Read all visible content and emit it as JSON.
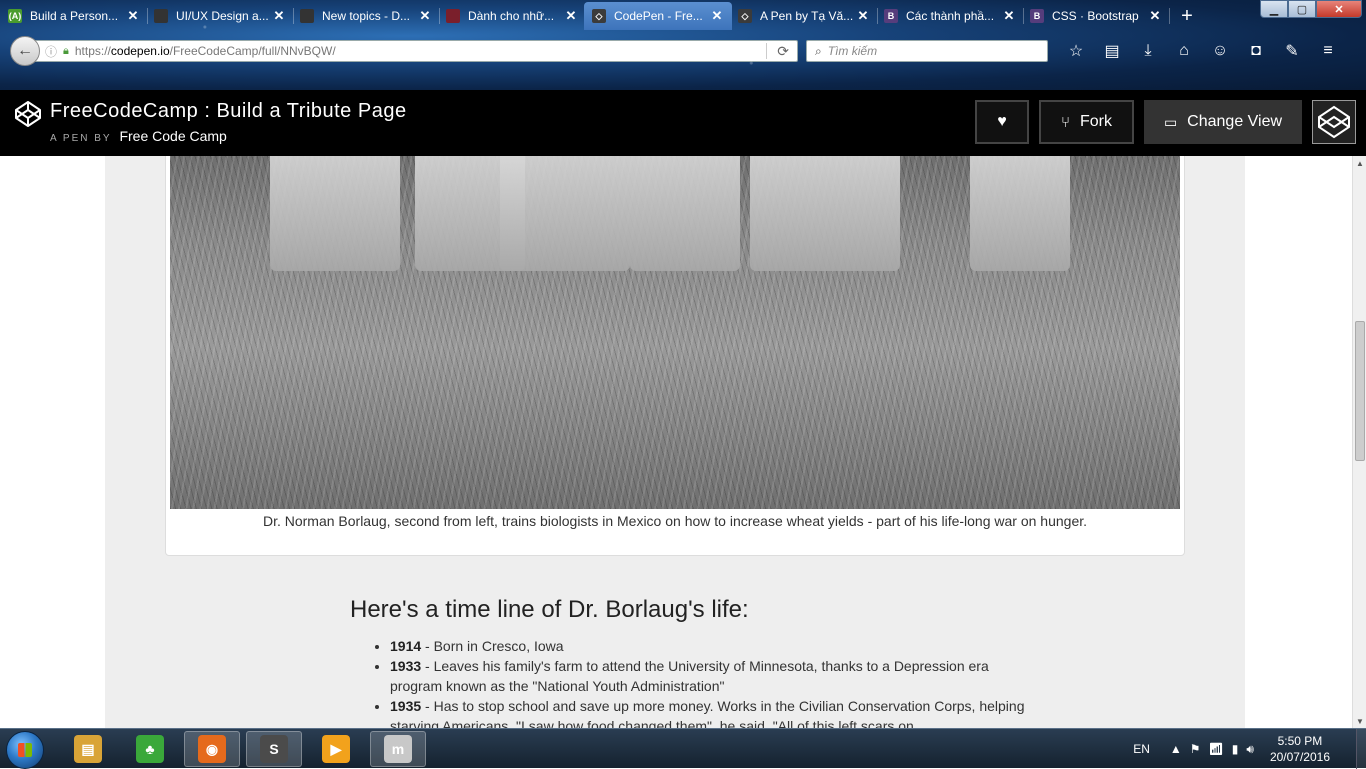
{
  "browser": {
    "tabs": [
      {
        "title": "Build a Person...",
        "icon": "freecodecamp-icon",
        "color": "#4a9c2e",
        "glyph": "(A)",
        "active": false
      },
      {
        "title": "UI/UX Design a...",
        "icon": "uiux-icon",
        "color": "#333333",
        "glyph": "",
        "active": false
      },
      {
        "title": "New topics - D...",
        "icon": "forum-icon",
        "color": "#333333",
        "glyph": "",
        "active": false
      },
      {
        "title": "Dành cho nhữ...",
        "icon": "book-icon",
        "color": "#7a1f2b",
        "glyph": "",
        "active": false
      },
      {
        "title": "CodePen - Fre...",
        "icon": "codepen-icon",
        "color": "#3b3b3b",
        "glyph": "◇",
        "active": true
      },
      {
        "title": "A Pen by Tạ Vă...",
        "icon": "codepen-icon",
        "color": "#3b3b3b",
        "glyph": "◇",
        "active": false
      },
      {
        "title": "Các thành phầ...",
        "icon": "bootstrap-icon",
        "color": "#563d7c",
        "glyph": "B",
        "active": false
      },
      {
        "title": "CSS · Bootstrap",
        "icon": "bootstrap-icon",
        "color": "#563d7c",
        "glyph": "B",
        "active": false
      }
    ],
    "url_prefix": "https://",
    "url_host": "codepen.io",
    "url_path": "/FreeCodeCamp/full/NNvBQW/",
    "search_placeholder": "Tìm kiếm"
  },
  "codepen": {
    "title": "FreeCodeCamp : Build a Tribute Page",
    "by_label": "A PEN BY",
    "author": "Free Code Camp",
    "fork_label": "Fork",
    "change_view_label": "Change View"
  },
  "page": {
    "caption": "Dr. Norman Borlaug, second from left, trains biologists in Mexico on how to increase wheat yields - part of his life-long war on hunger.",
    "timeline_heading": "Here's a time line of Dr. Borlaug's life:",
    "timeline": [
      {
        "year": "1914",
        "text": " - Born in Cresco, Iowa"
      },
      {
        "year": "1933",
        "text": " - Leaves his family's farm to attend the University of Minnesota, thanks to a Depression era program known as the \"National Youth Administration\""
      },
      {
        "year": "1935",
        "text": " - Has to stop school and save up more money. Works in the Civilian Conservation Corps, helping starving Americans. \"I saw how food changed them\", he said. \"All of this left scars on"
      }
    ]
  },
  "taskbar": {
    "apps": [
      {
        "name": "explorer",
        "color": "#d9a437",
        "glyph": "▤"
      },
      {
        "name": "parrot",
        "color": "#3aa83a",
        "glyph": "♣"
      },
      {
        "name": "firefox",
        "color": "#e56a1c",
        "glyph": "◉"
      },
      {
        "name": "sublime",
        "color": "#4b4b4b",
        "glyph": "S"
      },
      {
        "name": "media",
        "color": "#f2a21c",
        "glyph": "▶"
      },
      {
        "name": "mathtype",
        "color": "#c8c8c8",
        "glyph": "m"
      }
    ],
    "lang": "EN",
    "time": "5:50 PM",
    "date": "20/07/2016"
  }
}
